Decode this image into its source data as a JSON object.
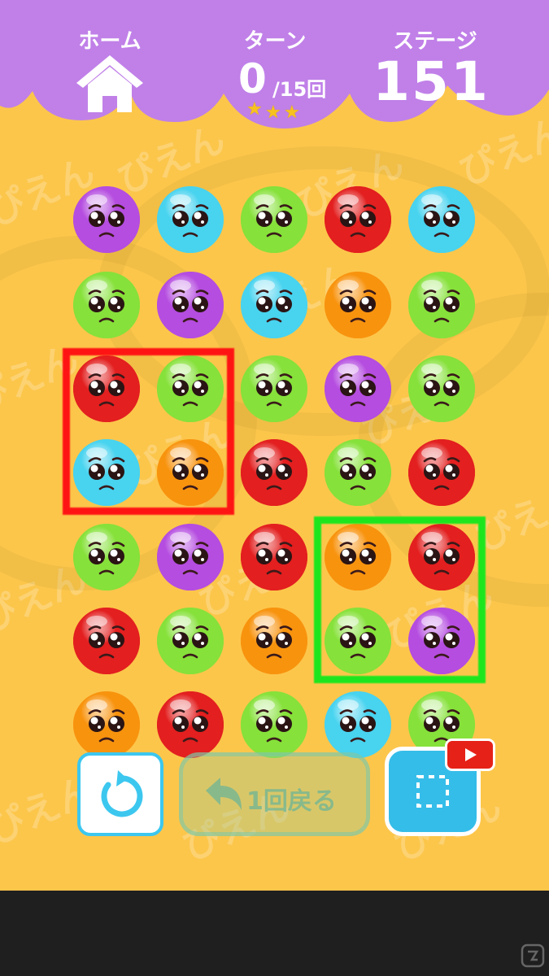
{
  "header": {
    "home_label": "ホーム",
    "turn_label": "ターン",
    "turn_current": "0",
    "turn_max": "/15回",
    "stage_label": "ステージ",
    "stage_number": "151",
    "stars": 3,
    "bg_color": "#c080e8"
  },
  "background": {
    "watermark_text": "ぴえん"
  },
  "board": {
    "rows": [
      [
        "purple",
        "cyan",
        "green",
        "red",
        "cyan"
      ],
      [
        "green",
        "purple",
        "cyan",
        "orange",
        "green"
      ],
      [
        "red",
        "green",
        "green",
        "purple",
        "green"
      ],
      [
        "cyan",
        "orange",
        "red",
        "green",
        "red"
      ],
      [
        "green",
        "purple",
        "red",
        "orange",
        "red"
      ],
      [
        "red",
        "green",
        "orange",
        "green",
        "purple"
      ],
      [
        "orange",
        "red",
        "green",
        "cyan",
        "green"
      ]
    ],
    "colors": {
      "purple": "#b54de0",
      "cyan": "#48d3ef",
      "green": "#86e13a",
      "red": "#e31f1f",
      "orange": "#f8930e"
    },
    "selections": [
      {
        "name": "red-selection",
        "color": "#ff1414",
        "row": 2,
        "col": 0,
        "rows": 2,
        "cols": 2
      },
      {
        "name": "green-selection",
        "color": "#1ee61e",
        "row": 4,
        "col": 3,
        "rows": 2,
        "cols": 2
      }
    ]
  },
  "controls": {
    "restart_icon": "restart-icon",
    "undo_label": "1回戻る",
    "hint_icon": "dashed-square-icon",
    "video_icon": "youtube-play-icon"
  }
}
